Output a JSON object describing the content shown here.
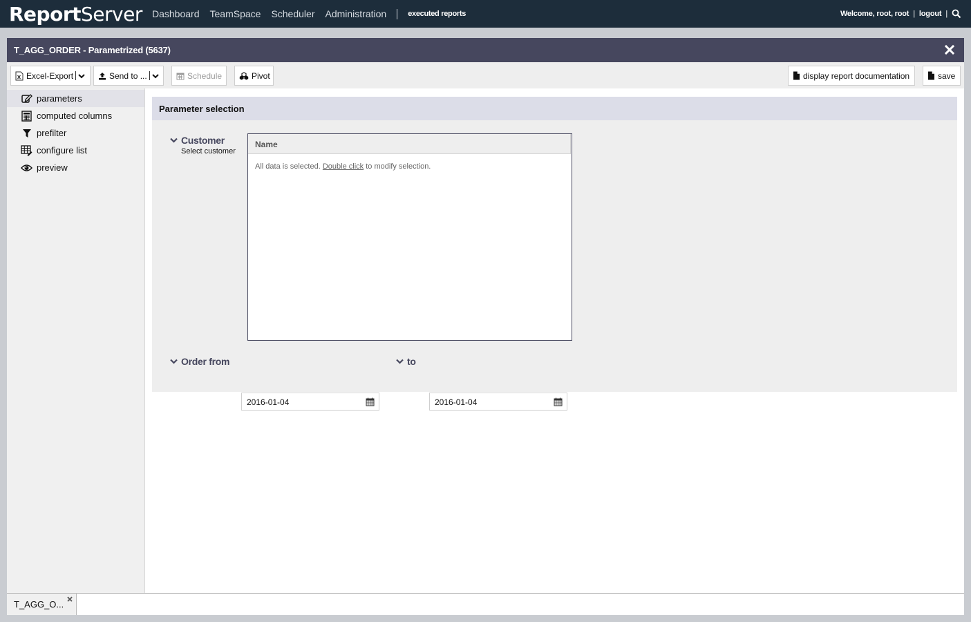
{
  "topbar": {
    "logo_bold": "Report",
    "logo_light": "Server",
    "nav": [
      "Dashboard",
      "TeamSpace",
      "Scheduler",
      "Administration"
    ],
    "executed_reports": "executed reports",
    "welcome": "Welcome, root, root",
    "logout": "logout"
  },
  "window": {
    "title": "T_AGG_ORDER - Parametrized (5637)"
  },
  "toolbar": {
    "excel_export": "Excel-Export",
    "send_to": "Send to ...",
    "schedule": "Schedule",
    "pivot": "Pivot",
    "display_doc": "display report documentation",
    "save": "save"
  },
  "sidebar": {
    "items": [
      {
        "label": "parameters",
        "icon": "edit-icon"
      },
      {
        "label": "computed columns",
        "icon": "calculator-icon"
      },
      {
        "label": "prefilter",
        "icon": "filter-icon"
      },
      {
        "label": "configure list",
        "icon": "table-edit-icon"
      },
      {
        "label": "preview",
        "icon": "eye-icon"
      }
    ]
  },
  "parameters": {
    "heading": "Parameter selection",
    "customer": {
      "name": "Customer",
      "description": "Select customer",
      "column_header": "Name",
      "msg_pre": "All data is selected. ",
      "msg_link": "Double click",
      "msg_post": " to modify selection."
    },
    "order_from": {
      "name": "Order from",
      "value": "2016-01-04"
    },
    "to": {
      "name": "to",
      "value": "2016-01-04"
    }
  },
  "tabs": [
    {
      "label": "T_AGG_O..."
    }
  ],
  "colors": {
    "topbar": "#1d2d3b",
    "window_title": "#46475e",
    "panel_head": "#dcdde8"
  }
}
